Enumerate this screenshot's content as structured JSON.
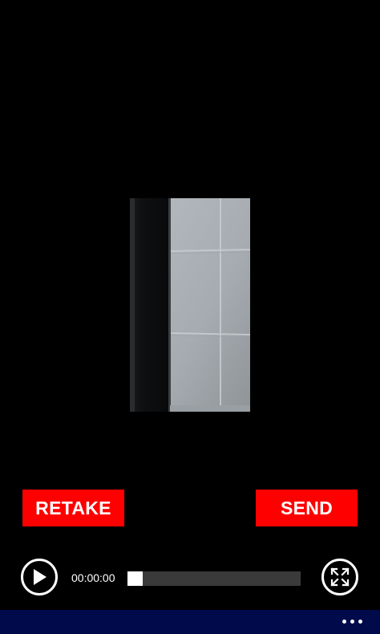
{
  "colors": {
    "background": "#000000",
    "action_button": "#ff0000",
    "app_bar": "#010a4a",
    "progress_track": "#3a3a3a"
  },
  "actions": {
    "retake_label": "RETAKE",
    "send_label": "SEND"
  },
  "player": {
    "time": "00:00:00",
    "progress_fraction": 0,
    "play_icon": "play-icon",
    "fullscreen_icon": "expand-icon"
  },
  "app_bar": {
    "more_icon": "ellipsis-icon"
  }
}
